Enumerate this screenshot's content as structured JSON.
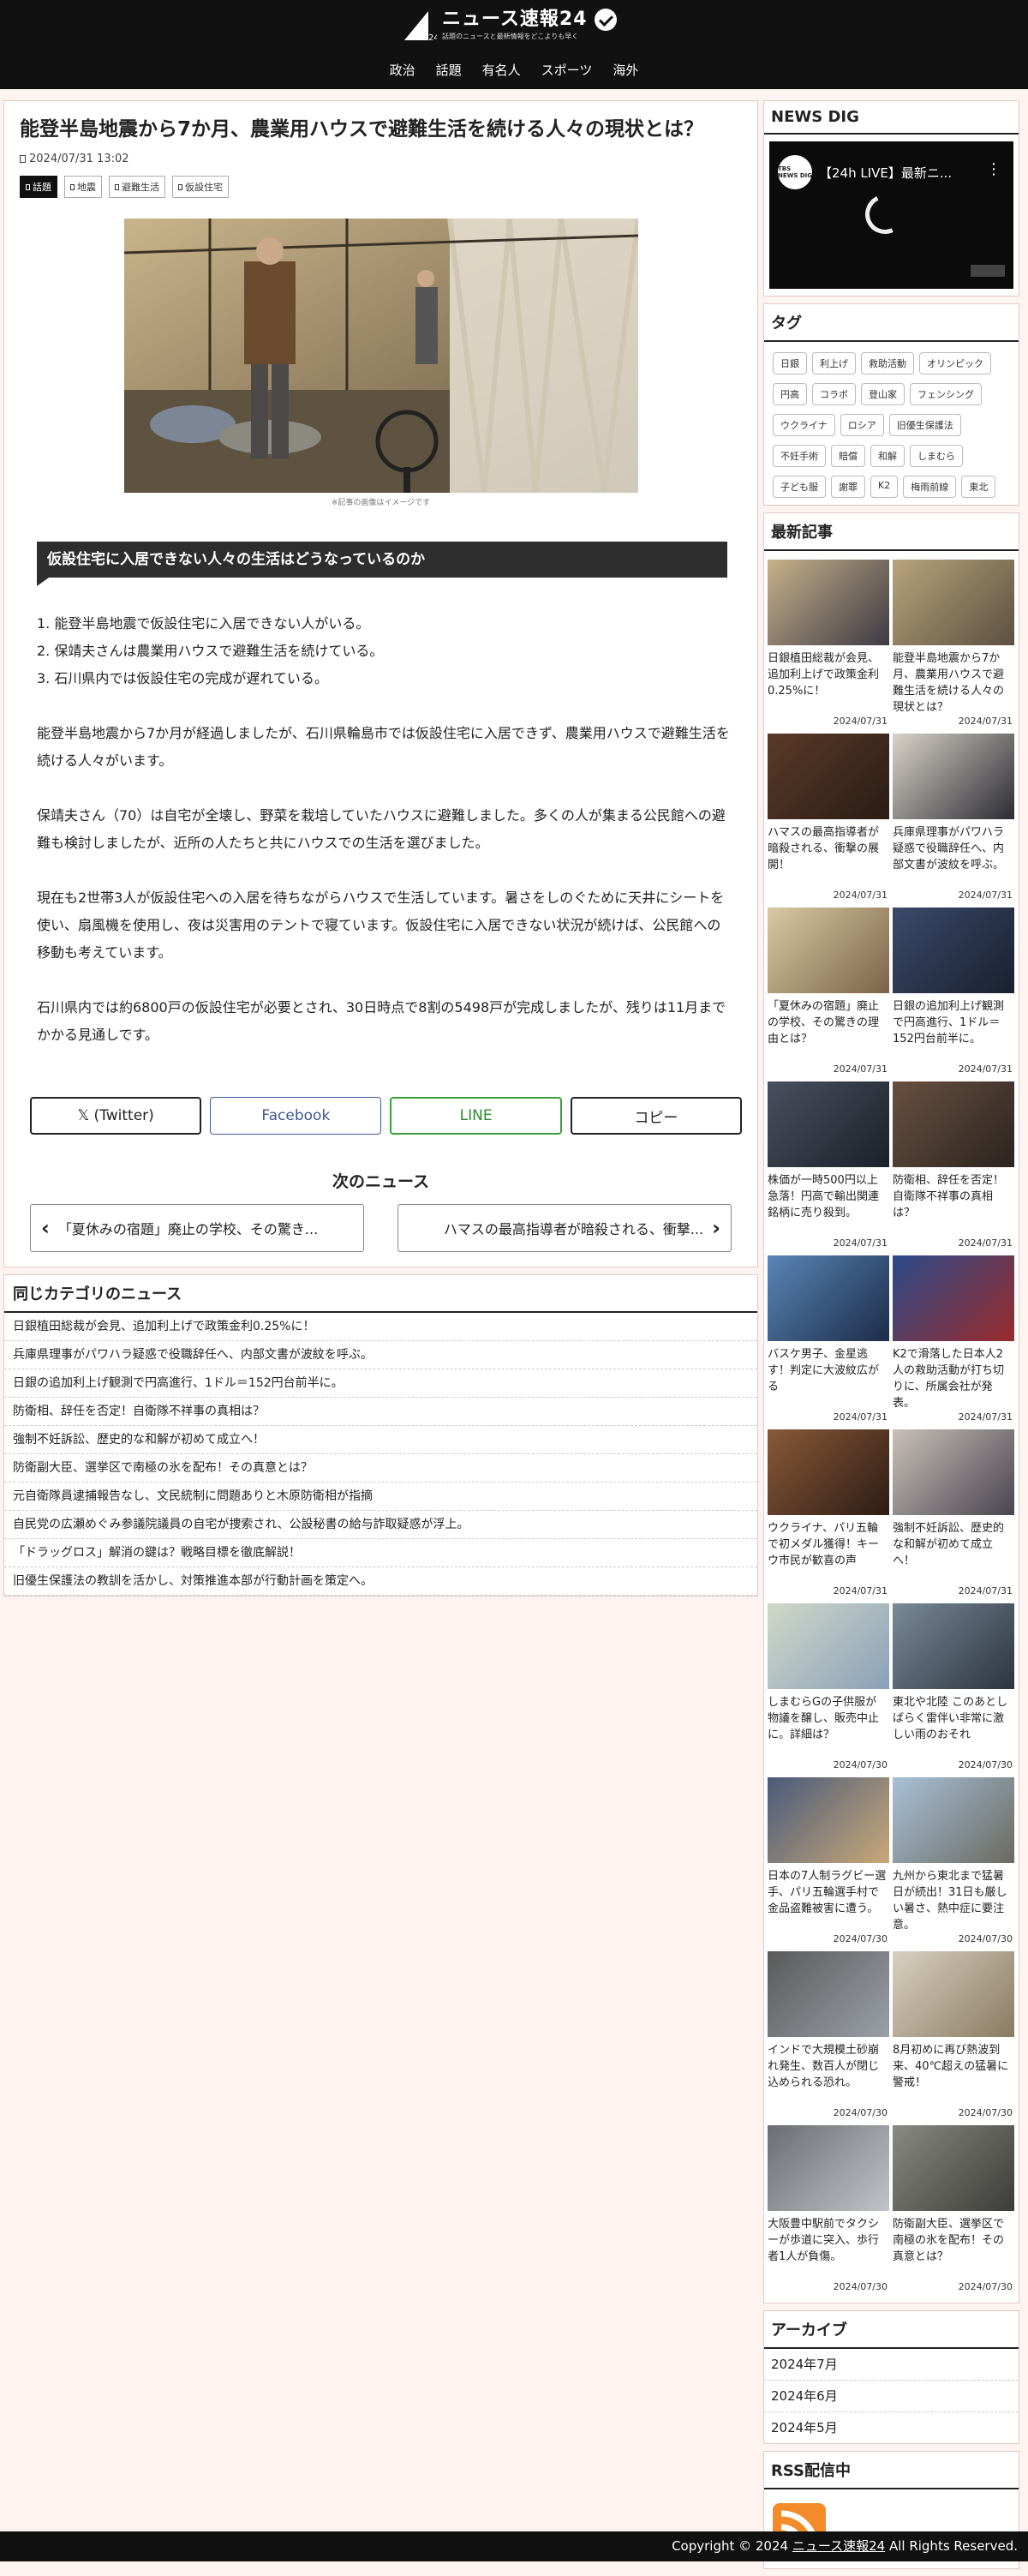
{
  "header": {
    "logo_title": "ニュース速報24",
    "logo_sub": "話題のニュースと最新情報をどこよりも早く",
    "logo_num": "24",
    "nav": [
      "政治",
      "話題",
      "有名人",
      "スポーツ",
      "海外"
    ]
  },
  "article": {
    "title": "能登半島地震から7か月、農業用ハウスで避難生活を続ける人々の現状とは？",
    "date": "2024/07/31 13:02",
    "tags": [
      "話題",
      "地震",
      "避難生活",
      "仮設住宅"
    ],
    "caption": "※記事の画像はイメージです",
    "section_heading": "仮設住宅に入居できない人々の生活はどうなっているのか",
    "summary": [
      "1. 能登半島地震で仮設住宅に入居できない人がいる。",
      "2. 保靖夫さんは農業用ハウスで避難生活を続けている。",
      "3. 石川県内では仮設住宅の完成が遅れている。"
    ],
    "paragraphs": [
      "能登半島地震から7か月が経過しましたが、石川県輪島市では仮設住宅に入居できず、農業用ハウスで避難生活を続ける人々がいます。",
      "保靖夫さん（70）は自宅が全壊し、野菜を栽培していたハウスに避難しました。多くの人が集まる公民館への避難も検討しましたが、近所の人たちと共にハウスでの生活を選びました。",
      "現在も2世帯3人が仮設住宅への入居を待ちながらハウスで生活しています。暑さをしのぐために天井にシートを使い、扇風機を使用し、夜は災害用のテントで寝ています。仮設住宅に入居できない状況が続けば、公民館への移動も考えています。",
      "石川県内では約6800戸の仮設住宅が必要とされ、30日時点で8割の5498戸が完成しましたが、残りは11月までかかる見通しです。"
    ],
    "share": {
      "twitter": "𝕏 (Twitter)",
      "facebook": "Facebook",
      "line": "LINE",
      "copy": "コピー"
    },
    "next_title": "次のニュース",
    "prev_link": "「夏休みの宿題」廃止の学校、その驚き...",
    "next_link": "ハマスの最高指導者が暗殺される、衝撃..."
  },
  "same_category": {
    "title": "同じカテゴリのニュース",
    "items": [
      "日銀植田総裁が会見、追加利上げで政策金利0.25%に！",
      "兵庫県理事がパワハラ疑惑で役職辞任へ、内部文書が波紋を呼ぶ。",
      "日銀の追加利上げ観測で円高進行、1ドル＝152円台前半に。",
      "防衛相、辞任を否定！自衛隊不祥事の真相は？",
      "強制不妊訴訟、歴史的な和解が初めて成立へ！",
      "防衛副大臣、選挙区で南極の氷を配布！その真意とは？",
      "元自衛隊員逮捕報告なし、文民統制に問題ありと木原防衛相が指摘",
      "自民党の広瀬めぐみ参議院議員の自宅が捜索され、公設秘書の給与詐取疑惑が浮上。",
      "「ドラッグロス」解消の鍵は？戦略目標を徹底解説！",
      "旧優生保護法の教訓を活かし、対策推進本部が行動計画を策定へ。"
    ]
  },
  "sidebar": {
    "newsdig_title": "NEWS DIG",
    "yt_channel": "TBS NEWS DIG",
    "yt_title": "【24h LIVE】最新ニ...",
    "tags_title": "タグ",
    "tags": [
      "日銀",
      "利上げ",
      "救助活動",
      "オリンピック",
      "円高",
      "コラボ",
      "登山家",
      "フェンシング",
      "ウクライナ",
      "ロシア",
      "旧優生保護法",
      "不妊手術",
      "賠償",
      "和解",
      "しまむら",
      "子ども服",
      "謝罪",
      "K2",
      "梅雨前線",
      "東北"
    ],
    "latest_title": "最新記事",
    "latest": [
      {
        "title": "日銀植田総裁が会見、追加利上げで政策金利0.25%に！",
        "date": "2024/07/31"
      },
      {
        "title": "能登半島地震から7か月、農業用ハウスで避難生活を続ける人々の現状とは？",
        "date": "2024/07/31"
      },
      {
        "title": "ハマスの最高指導者が暗殺される、衝撃の展開！",
        "date": "2024/07/31"
      },
      {
        "title": "兵庫県理事がパワハラ疑惑で役職辞任へ、内部文書が波紋を呼ぶ。",
        "date": "2024/07/31"
      },
      {
        "title": "「夏休みの宿題」廃止の学校、その驚きの理由とは？",
        "date": "2024/07/31"
      },
      {
        "title": "日銀の追加利上げ観測で円高進行、1ドル＝152円台前半に。",
        "date": "2024/07/31"
      },
      {
        "title": "株価が一時500円以上急落！円高で輸出関連銘柄に売り殺到。",
        "date": "2024/07/31"
      },
      {
        "title": "防衛相、辞任を否定！自衛隊不祥事の真相は？",
        "date": "2024/07/31"
      },
      {
        "title": "バスケ男子、金星逃す！判定に大波紋広がる",
        "date": "2024/07/31"
      },
      {
        "title": "K2で滑落した日本人2人の救助活動が打ち切りに、所属会社が発表。",
        "date": "2024/07/31"
      },
      {
        "title": "ウクライナ、パリ五輪で初メダル獲得！キーウ市民が歓喜の声",
        "date": "2024/07/31"
      },
      {
        "title": "強制不妊訴訟、歴史的な和解が初めて成立へ！",
        "date": "2024/07/31"
      },
      {
        "title": "しまむらGの子供服が物議を醸し、販売中止に。詳細は？",
        "date": "2024/07/30"
      },
      {
        "title": "東北や北陸 このあとしばらく雷伴い非常に激しい雨のおそれ",
        "date": "2024/07/30"
      },
      {
        "title": "日本の7人制ラグビー選手、パリ五輪選手村で金品盗難被害に遭う。",
        "date": "2024/07/30"
      },
      {
        "title": "九州から東北まで猛暑日が続出！31日も厳しい暑さ、熱中症に要注意。",
        "date": "2024/07/30"
      },
      {
        "title": "インドで大規模土砂崩れ発生、数百人が閉じ込められる恐れ。",
        "date": "2024/07/30"
      },
      {
        "title": "8月初めに再び熱波到来、40℃超えの猛暑に警戒！",
        "date": "2024/07/30"
      },
      {
        "title": "大阪豊中駅前でタクシーが歩道に突入、歩行者1人が負傷。",
        "date": "2024/07/30"
      },
      {
        "title": "防衛副大臣、選挙区で南極の氷を配布！その真意とは？",
        "date": "2024/07/30"
      }
    ],
    "archive_title": "アーカイブ",
    "archive": [
      "2024年7月",
      "2024年6月",
      "2024年5月"
    ],
    "rss_title": "RSS配信中"
  },
  "footer": {
    "prefix": "Copyright © 2024 ",
    "site": "ニュース速報24",
    "suffix": " All Rights Reserved."
  }
}
